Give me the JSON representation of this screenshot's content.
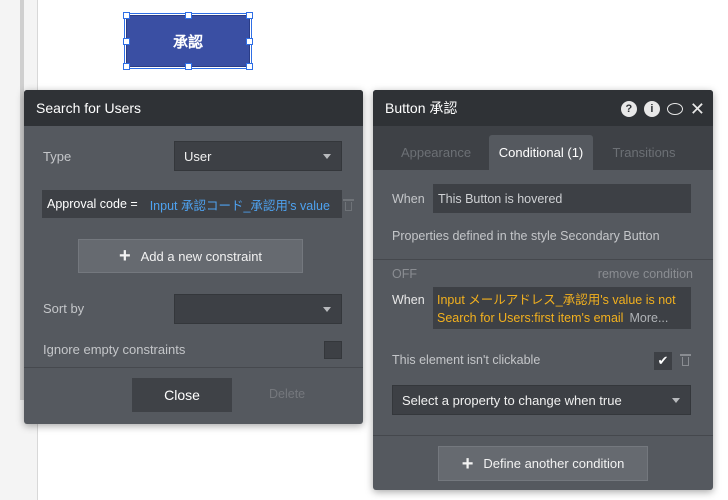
{
  "canvas": {
    "button_label": "承認"
  },
  "search_panel": {
    "title": "Search for Users",
    "type_label": "Type",
    "type_value": "User",
    "constraint": {
      "key": "Approval code =",
      "value": "Input 承認コード_承認用's value"
    },
    "add_constraint_label": "Add a new constraint",
    "sort_by_label": "Sort by",
    "sort_by_value": "",
    "ignore_empty_label": "Ignore empty constraints",
    "close_label": "Close",
    "delete_label": "Delete"
  },
  "button_panel": {
    "title": "Button 承認",
    "tabs": [
      {
        "label": "Appearance",
        "active": false
      },
      {
        "label": "Conditional (1)",
        "active": true
      },
      {
        "label": "Transitions",
        "active": false
      }
    ],
    "when_label": "When",
    "when_value": "This Button is hovered",
    "style_note": "Properties defined in the style Secondary Button",
    "off_label": "OFF",
    "remove_condition_label": "remove condition",
    "condition_when_label": "When",
    "condition_text_line1": "Input メールアドレス_承認用's value is not",
    "condition_text_line2": "Search for Users:first item's email",
    "more_label": "More...",
    "not_clickable_label": "This element isn't clickable",
    "not_clickable_checked": true,
    "property_select_label": "Select a property to change when true",
    "define_condition_label": "Define another condition"
  },
  "icons": {
    "help": "question-circle-icon",
    "info": "info-circle-icon",
    "comment": "comment-bubble-icon",
    "close": "close-x-icon",
    "plus": "plus-icon",
    "trash": "trash-icon",
    "caret": "caret-down-icon",
    "check": "checkmark-icon"
  }
}
